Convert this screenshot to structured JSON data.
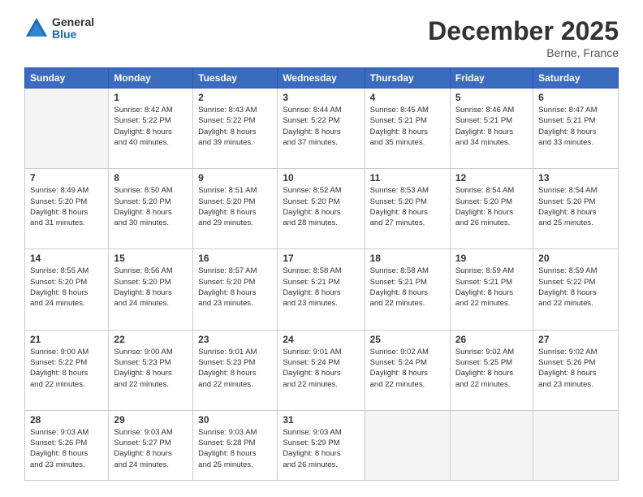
{
  "logo": {
    "general": "General",
    "blue": "Blue"
  },
  "header": {
    "month": "December 2025",
    "location": "Berne, France"
  },
  "days_of_week": [
    "Sunday",
    "Monday",
    "Tuesday",
    "Wednesday",
    "Thursday",
    "Friday",
    "Saturday"
  ],
  "weeks": [
    [
      {
        "day": "",
        "sunrise": "",
        "sunset": "",
        "daylight": ""
      },
      {
        "day": "1",
        "sunrise": "Sunrise: 8:42 AM",
        "sunset": "Sunset: 5:22 PM",
        "daylight": "Daylight: 8 hours and 40 minutes."
      },
      {
        "day": "2",
        "sunrise": "Sunrise: 8:43 AM",
        "sunset": "Sunset: 5:22 PM",
        "daylight": "Daylight: 8 hours and 39 minutes."
      },
      {
        "day": "3",
        "sunrise": "Sunrise: 8:44 AM",
        "sunset": "Sunset: 5:22 PM",
        "daylight": "Daylight: 8 hours and 37 minutes."
      },
      {
        "day": "4",
        "sunrise": "Sunrise: 8:45 AM",
        "sunset": "Sunset: 5:21 PM",
        "daylight": "Daylight: 8 hours and 35 minutes."
      },
      {
        "day": "5",
        "sunrise": "Sunrise: 8:46 AM",
        "sunset": "Sunset: 5:21 PM",
        "daylight": "Daylight: 8 hours and 34 minutes."
      },
      {
        "day": "6",
        "sunrise": "Sunrise: 8:47 AM",
        "sunset": "Sunset: 5:21 PM",
        "daylight": "Daylight: 8 hours and 33 minutes."
      }
    ],
    [
      {
        "day": "7",
        "sunrise": "Sunrise: 8:49 AM",
        "sunset": "Sunset: 5:20 PM",
        "daylight": "Daylight: 8 hours and 31 minutes."
      },
      {
        "day": "8",
        "sunrise": "Sunrise: 8:50 AM",
        "sunset": "Sunset: 5:20 PM",
        "daylight": "Daylight: 8 hours and 30 minutes."
      },
      {
        "day": "9",
        "sunrise": "Sunrise: 8:51 AM",
        "sunset": "Sunset: 5:20 PM",
        "daylight": "Daylight: 8 hours and 29 minutes."
      },
      {
        "day": "10",
        "sunrise": "Sunrise: 8:52 AM",
        "sunset": "Sunset: 5:20 PM",
        "daylight": "Daylight: 8 hours and 28 minutes."
      },
      {
        "day": "11",
        "sunrise": "Sunrise: 8:53 AM",
        "sunset": "Sunset: 5:20 PM",
        "daylight": "Daylight: 8 hours and 27 minutes."
      },
      {
        "day": "12",
        "sunrise": "Sunrise: 8:54 AM",
        "sunset": "Sunset: 5:20 PM",
        "daylight": "Daylight: 8 hours and 26 minutes."
      },
      {
        "day": "13",
        "sunrise": "Sunrise: 8:54 AM",
        "sunset": "Sunset: 5:20 PM",
        "daylight": "Daylight: 8 hours and 25 minutes."
      }
    ],
    [
      {
        "day": "14",
        "sunrise": "Sunrise: 8:55 AM",
        "sunset": "Sunset: 5:20 PM",
        "daylight": "Daylight: 8 hours and 24 minutes."
      },
      {
        "day": "15",
        "sunrise": "Sunrise: 8:56 AM",
        "sunset": "Sunset: 5:20 PM",
        "daylight": "Daylight: 8 hours and 24 minutes."
      },
      {
        "day": "16",
        "sunrise": "Sunrise: 8:57 AM",
        "sunset": "Sunset: 5:20 PM",
        "daylight": "Daylight: 8 hours and 23 minutes."
      },
      {
        "day": "17",
        "sunrise": "Sunrise: 8:58 AM",
        "sunset": "Sunset: 5:21 PM",
        "daylight": "Daylight: 8 hours and 23 minutes."
      },
      {
        "day": "18",
        "sunrise": "Sunrise: 8:58 AM",
        "sunset": "Sunset: 5:21 PM",
        "daylight": "Daylight: 8 hours and 22 minutes."
      },
      {
        "day": "19",
        "sunrise": "Sunrise: 8:59 AM",
        "sunset": "Sunset: 5:21 PM",
        "daylight": "Daylight: 8 hours and 22 minutes."
      },
      {
        "day": "20",
        "sunrise": "Sunrise: 8:59 AM",
        "sunset": "Sunset: 5:22 PM",
        "daylight": "Daylight: 8 hours and 22 minutes."
      }
    ],
    [
      {
        "day": "21",
        "sunrise": "Sunrise: 9:00 AM",
        "sunset": "Sunset: 5:22 PM",
        "daylight": "Daylight: 8 hours and 22 minutes."
      },
      {
        "day": "22",
        "sunrise": "Sunrise: 9:00 AM",
        "sunset": "Sunset: 5:23 PM",
        "daylight": "Daylight: 8 hours and 22 minutes."
      },
      {
        "day": "23",
        "sunrise": "Sunrise: 9:01 AM",
        "sunset": "Sunset: 5:23 PM",
        "daylight": "Daylight: 8 hours and 22 minutes."
      },
      {
        "day": "24",
        "sunrise": "Sunrise: 9:01 AM",
        "sunset": "Sunset: 5:24 PM",
        "daylight": "Daylight: 8 hours and 22 minutes."
      },
      {
        "day": "25",
        "sunrise": "Sunrise: 9:02 AM",
        "sunset": "Sunset: 5:24 PM",
        "daylight": "Daylight: 8 hours and 22 minutes."
      },
      {
        "day": "26",
        "sunrise": "Sunrise: 9:02 AM",
        "sunset": "Sunset: 5:25 PM",
        "daylight": "Daylight: 8 hours and 22 minutes."
      },
      {
        "day": "27",
        "sunrise": "Sunrise: 9:02 AM",
        "sunset": "Sunset: 5:26 PM",
        "daylight": "Daylight: 8 hours and 23 minutes."
      }
    ],
    [
      {
        "day": "28",
        "sunrise": "Sunrise: 9:03 AM",
        "sunset": "Sunset: 5:26 PM",
        "daylight": "Daylight: 8 hours and 23 minutes."
      },
      {
        "day": "29",
        "sunrise": "Sunrise: 9:03 AM",
        "sunset": "Sunset: 5:27 PM",
        "daylight": "Daylight: 8 hours and 24 minutes."
      },
      {
        "day": "30",
        "sunrise": "Sunrise: 9:03 AM",
        "sunset": "Sunset: 5:28 PM",
        "daylight": "Daylight: 8 hours and 25 minutes."
      },
      {
        "day": "31",
        "sunrise": "Sunrise: 9:03 AM",
        "sunset": "Sunset: 5:29 PM",
        "daylight": "Daylight: 8 hours and 26 minutes."
      },
      {
        "day": "",
        "sunrise": "",
        "sunset": "",
        "daylight": ""
      },
      {
        "day": "",
        "sunrise": "",
        "sunset": "",
        "daylight": ""
      },
      {
        "day": "",
        "sunrise": "",
        "sunset": "",
        "daylight": ""
      }
    ]
  ]
}
